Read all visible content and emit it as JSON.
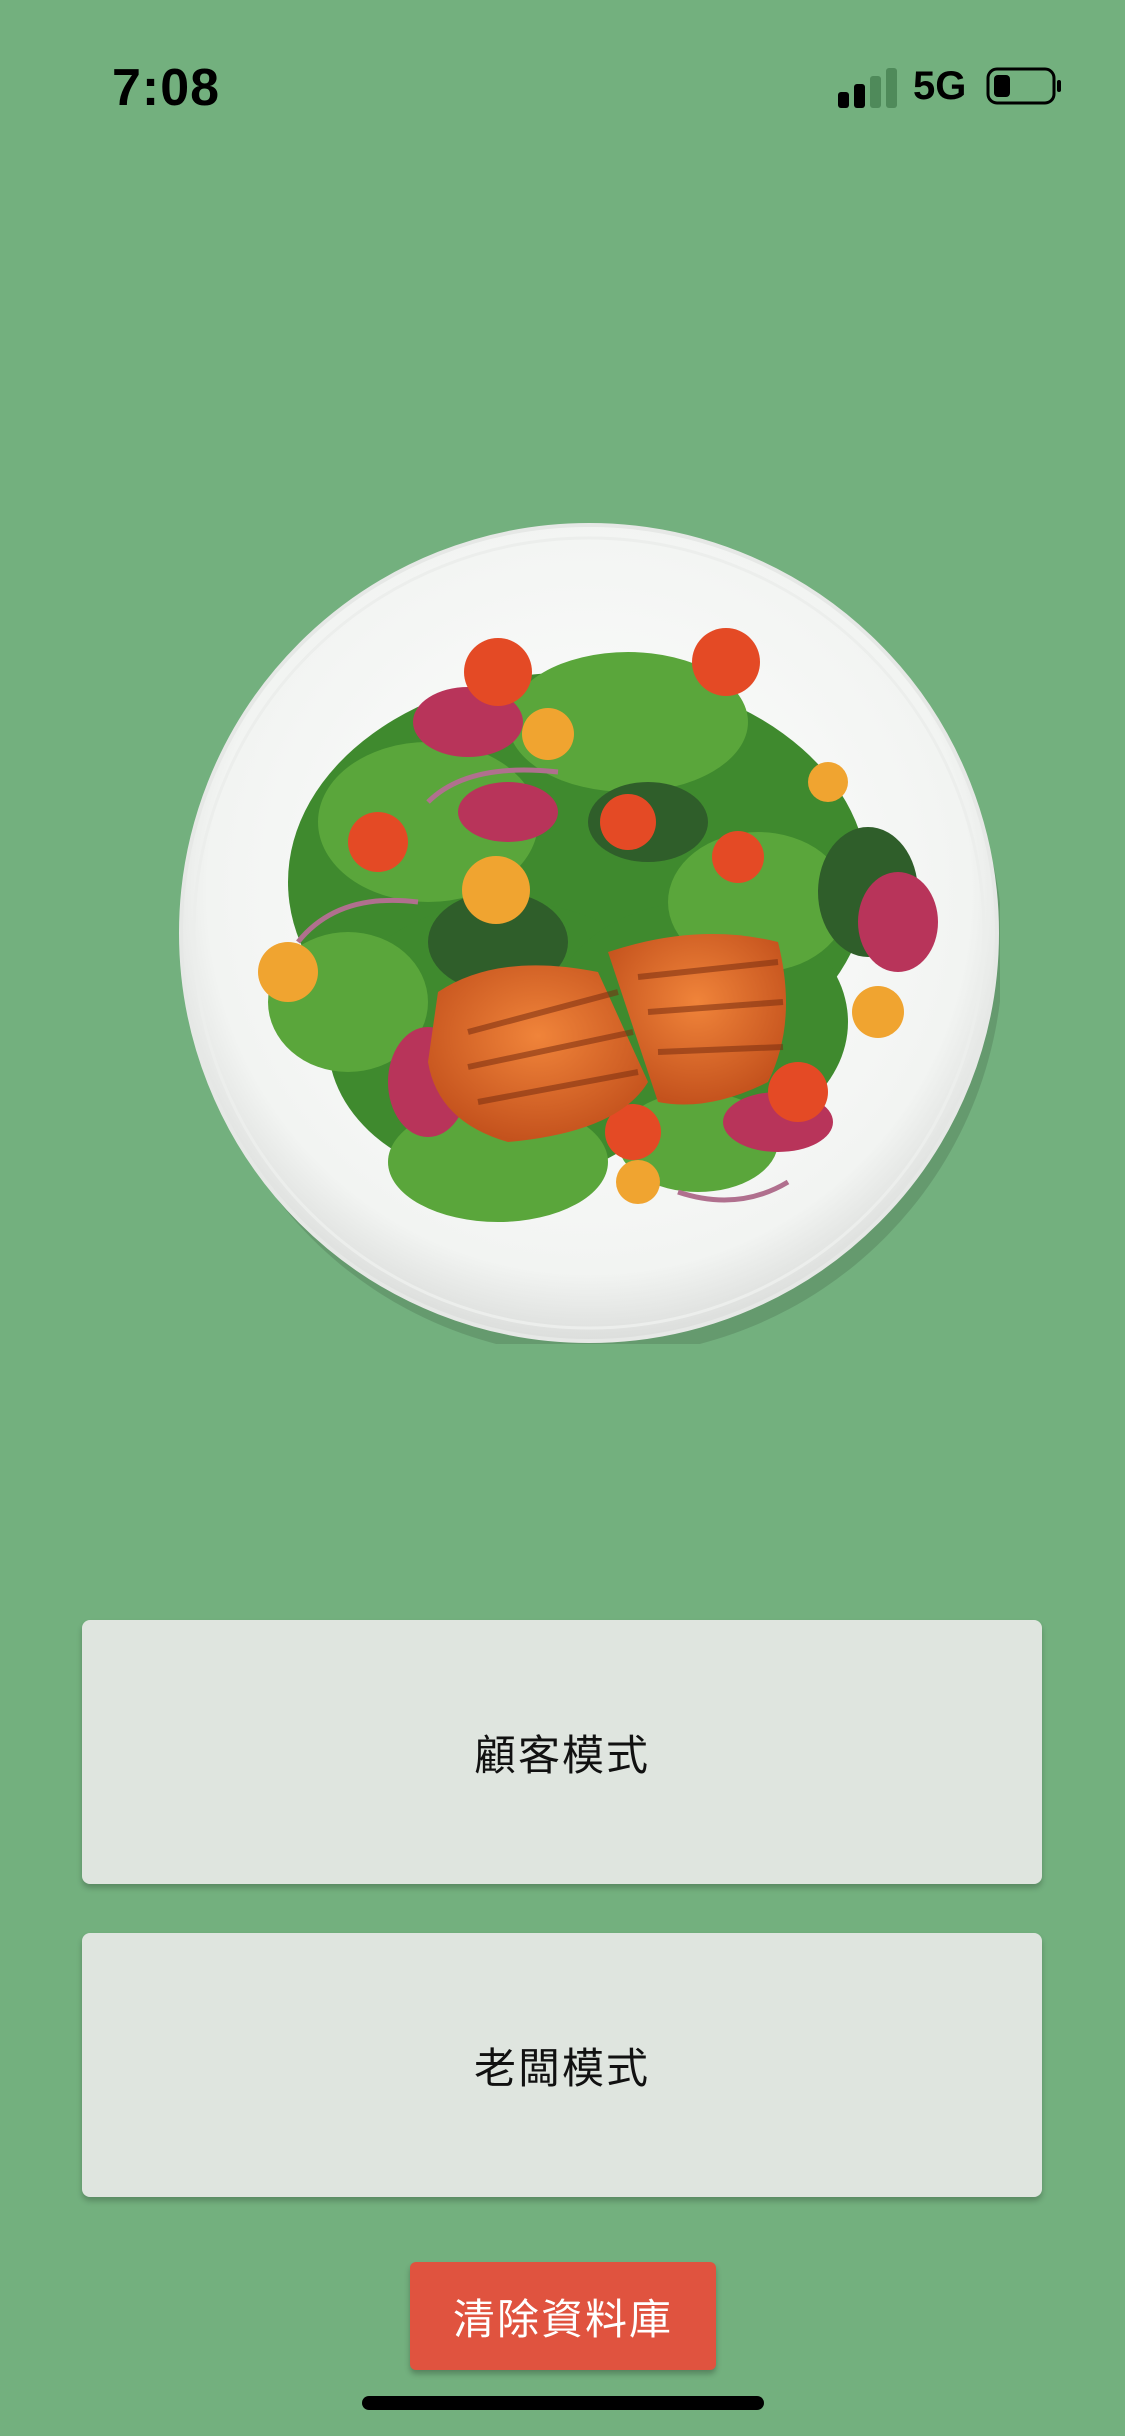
{
  "status_bar": {
    "time": "7:08",
    "network": "5G",
    "signal_bars_active": 2,
    "signal_bars_total": 4,
    "battery_level": 0.3
  },
  "hero": {
    "image_icon": "salad-plate-image"
  },
  "buttons": {
    "customer_mode": "顧客模式",
    "owner_mode": "老闆模式",
    "clear_database": "清除資料庫"
  },
  "colors": {
    "background": "#73b07e",
    "button_background": "#dfe5df",
    "danger": "#e0533f"
  }
}
